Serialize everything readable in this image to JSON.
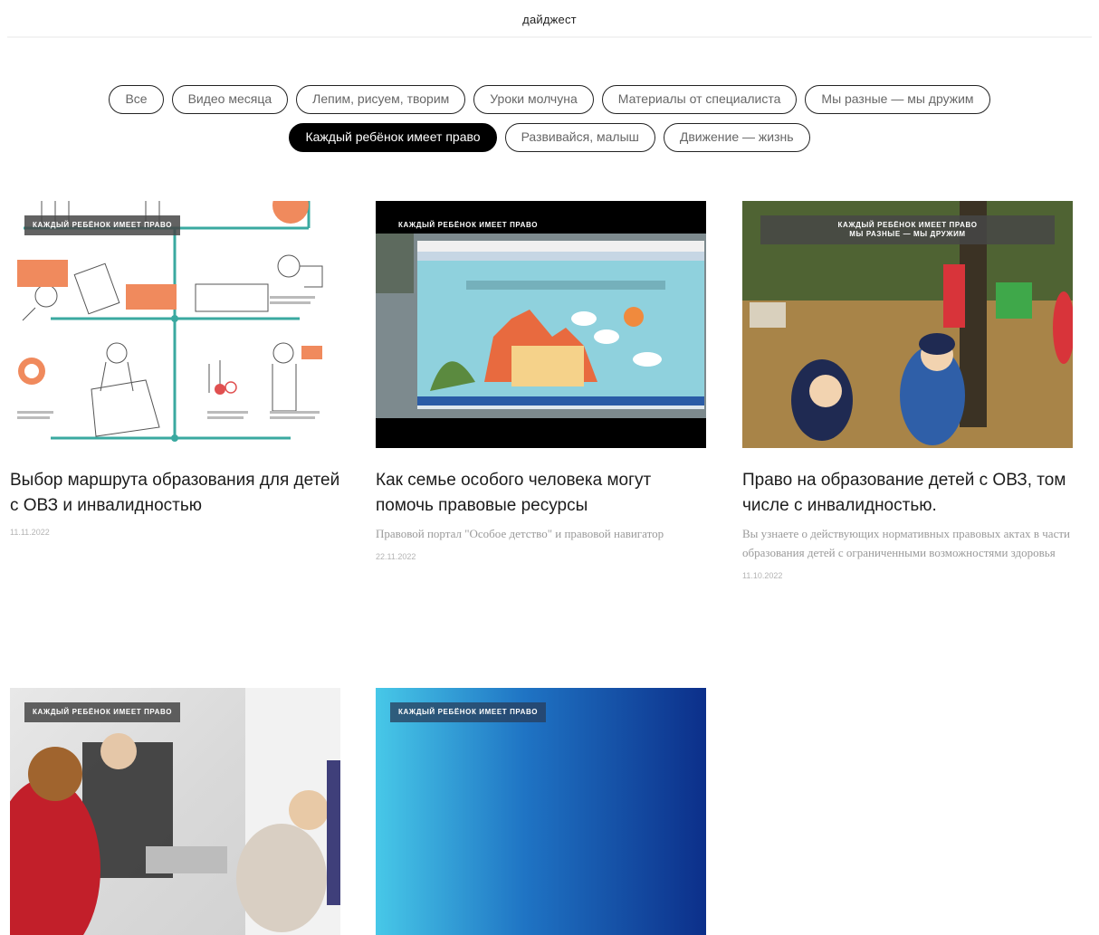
{
  "header": {
    "title": "дайджест"
  },
  "filters": {
    "row1": [
      "Все",
      "Видео месяца",
      "Лепим, рисуем, творим",
      "Уроки молчуна",
      "Материалы от специалиста",
      "Мы разные — мы дружим"
    ],
    "row2": [
      "Каждый ребёнок имеет право",
      "Развивайся, малыш",
      "Движение — жизнь"
    ],
    "active": "Каждый ребёнок имеет право"
  },
  "cards": [
    {
      "tag": "Каждый ребёнок имеет право",
      "title": "Выбор маршрута образования для детей с ОВЗ и инвалидностью",
      "desc": "",
      "date": "11.11.2022"
    },
    {
      "tag": "Каждый ребёнок имеет право",
      "title": "Как семье особого человека могут помочь правовые ресурсы",
      "desc": "Правовой портал \"Особое детство\" и правовой навигатор",
      "date": "22.11.2022"
    },
    {
      "tag": "Каждый ребёнок имеет право",
      "tag2": "Мы разные — мы дружим",
      "title": "Право на образование детей с ОВЗ, том числе с инвалидностью.",
      "desc": "Вы узнаете о действующих нормативных правовых актах в части образования детей с ограниченными возможностями здоровья",
      "date": "11.10.2022"
    },
    {
      "tag": "Каждый ребёнок имеет право",
      "title": "",
      "desc": "",
      "date": ""
    },
    {
      "tag": "Каждый ребёнок имеет право",
      "title": "",
      "desc": "",
      "date": ""
    }
  ],
  "colors": {
    "accent": "#000000",
    "infographic_teal": "#3aa9a0",
    "infographic_orange": "#f08a5d",
    "gradient_start": "#47c8e8",
    "gradient_end": "#0c2f8a"
  }
}
